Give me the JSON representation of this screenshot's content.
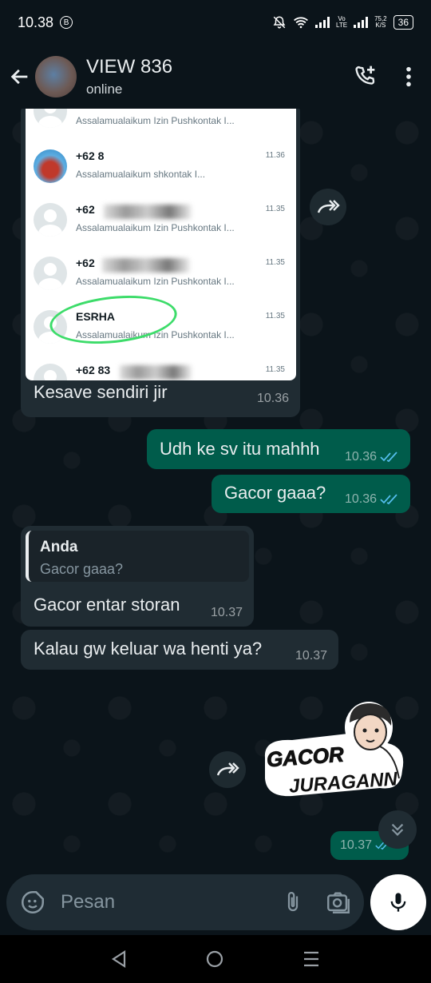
{
  "status_bar": {
    "time": "10.38",
    "badge": "B",
    "net_top": "Vo",
    "net_bottom": "LTE",
    "speed_value": "75,2",
    "speed_unit": "K/S",
    "battery": "36"
  },
  "header": {
    "contact_name": "VIEW 836",
    "status": "online"
  },
  "shared_screenshot": {
    "rows": [
      {
        "name": "",
        "time": "",
        "message": "Assalamualaikum Izin Pushkontak I..."
      },
      {
        "name": "+62 8",
        "time": "11.36",
        "message": "Assalamualaikum shkontak I..."
      },
      {
        "name": "+62",
        "time": "11.35",
        "message": "Assalamualaikum Izin Pushkontak I..."
      },
      {
        "name": "+62",
        "time": "11.35",
        "message": "Assalamualaikum Izin Pushkontak I..."
      },
      {
        "name": "ESRHA",
        "time": "11.35",
        "message": "Assalamualaikum Izin Pushkontak I..."
      },
      {
        "name": "+62 83",
        "time": "11.35",
        "message": ""
      }
    ]
  },
  "messages": [
    {
      "direction": "in",
      "text": "Kesave sendiri jir",
      "time": "10.36"
    },
    {
      "direction": "out",
      "text": "Udh ke sv itu mahhh",
      "time": "10.36"
    },
    {
      "direction": "out",
      "text": "Gacor gaaa?",
      "time": "10.36"
    },
    {
      "direction": "in",
      "reply_author": "Anda",
      "reply_text": "Gacor gaaa?",
      "text": "Gacor entar storan",
      "time": "10.37"
    },
    {
      "direction": "in",
      "text": "Kalau gw keluar wa henti ya?",
      "time": "10.37"
    },
    {
      "direction": "out",
      "sticker_text_1": "GACOR",
      "sticker_text_2": "JURAGANN",
      "time": ""
    },
    {
      "direction": "out",
      "text": "",
      "time": "10.37"
    }
  ],
  "input": {
    "placeholder": "Pesan"
  },
  "colors": {
    "background": "#0b141a",
    "incoming": "#202c33",
    "outgoing": "#005c4b",
    "read_ticks": "#53bdeb",
    "highlight_circle": "#3ddc6a"
  }
}
